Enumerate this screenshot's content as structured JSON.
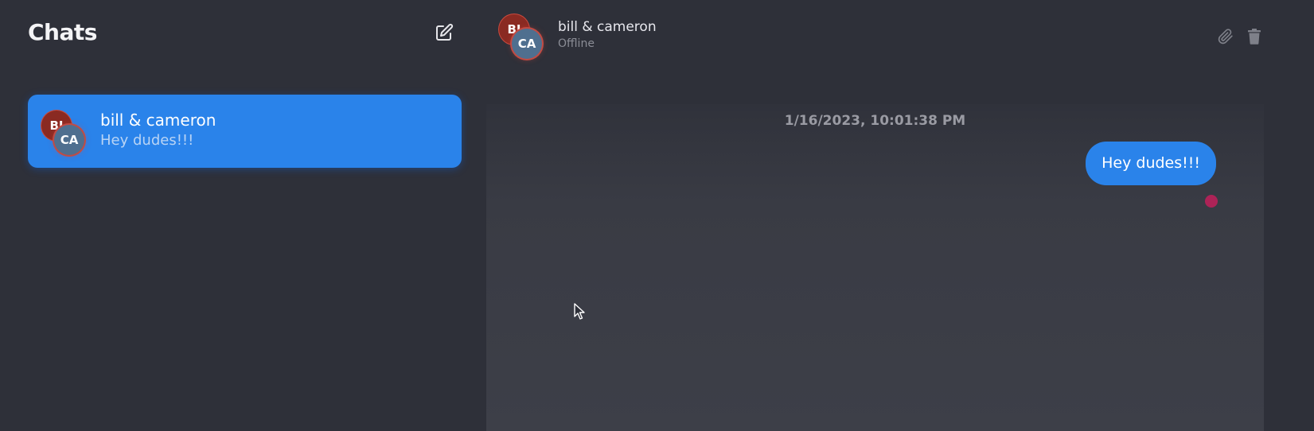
{
  "sidebar": {
    "title": "Chats",
    "compose_icon": "compose-icon",
    "chats": [
      {
        "name": "bill & cameron",
        "preview": "Hey dudes!!!",
        "avatars": [
          "BI",
          "CA"
        ],
        "selected": true
      }
    ]
  },
  "conversation": {
    "name": "bill & cameron",
    "status": "Offline",
    "avatars": [
      "BI",
      "CA"
    ],
    "header_icons": [
      "paperclip-icon",
      "trash-icon"
    ],
    "messages": [
      {
        "timestamp": "1/16/2023, 10:01:38 PM",
        "text": "Hey dudes!!!",
        "outgoing": true
      }
    ]
  },
  "colors": {
    "background": "#2e3039",
    "accent": "#2a83ea",
    "avatar_bi": "#8a2a22",
    "avatar_ca": "#4f6f8f",
    "read_indicator": "#c2205a"
  }
}
